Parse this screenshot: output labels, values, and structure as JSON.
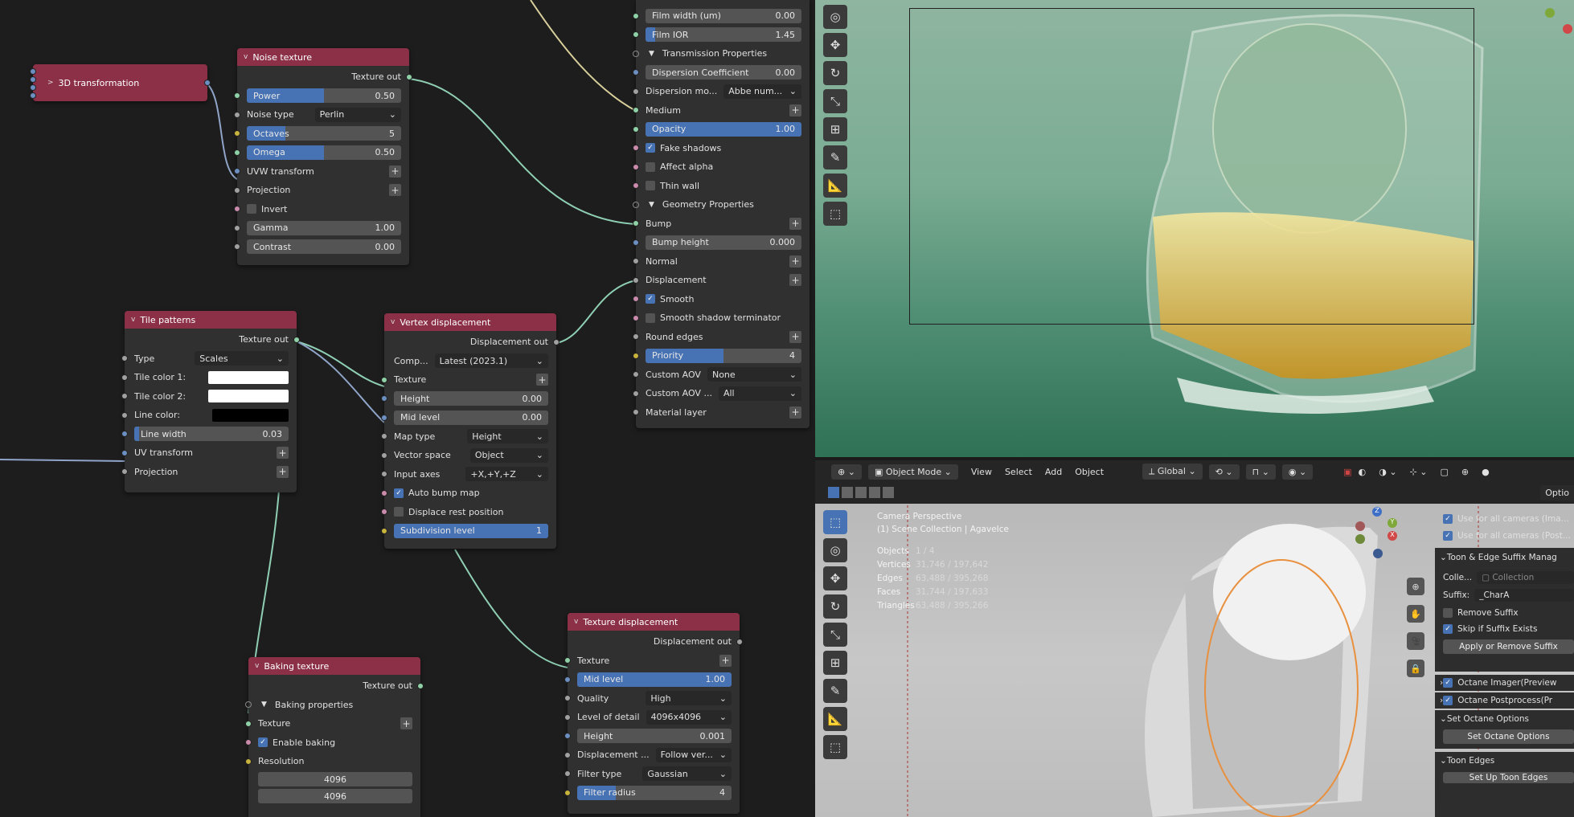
{
  "noise": {
    "title": "Noise texture",
    "out": "Texture out",
    "power": {
      "label": "Power",
      "value": "0.50"
    },
    "noise_type": {
      "label": "Noise type",
      "value": "Perlin"
    },
    "octaves": {
      "label": "Octaves",
      "value": "5"
    },
    "omega": {
      "label": "Omega",
      "value": "0.50"
    },
    "uvw": "UVW transform",
    "projection": "Projection",
    "invert": "Invert",
    "gamma": {
      "label": "Gamma",
      "value": "1.00"
    },
    "contrast": {
      "label": "Contrast",
      "value": "0.00"
    }
  },
  "transform3d": {
    "title": "3D transformation"
  },
  "tile": {
    "title": "Tile patterns",
    "out": "Texture out",
    "type": {
      "label": "Type",
      "value": "Scales"
    },
    "c1": "Tile color 1:",
    "c2": "Tile color 2:",
    "lc": "Line color:",
    "line_width": {
      "label": "Line width",
      "value": "0.03"
    },
    "uv": "UV transform",
    "projection": "Projection"
  },
  "vertex": {
    "title": "Vertex displacement",
    "out": "Displacement out",
    "comp": {
      "label": "Comp...",
      "value": "Latest (2023.1)"
    },
    "texture": "Texture",
    "height": {
      "label": "Height",
      "value": "0.00"
    },
    "mid": {
      "label": "Mid level",
      "value": "0.00"
    },
    "map_type": {
      "label": "Map type",
      "value": "Height"
    },
    "vector_space": {
      "label": "Vector space",
      "value": "Object"
    },
    "input_axes": {
      "label": "Input axes",
      "value": "+X,+Y,+Z"
    },
    "auto_bump": "Auto bump map",
    "displace_rest": "Displace rest position",
    "subdiv": {
      "label": "Subdivision level",
      "value": "1"
    }
  },
  "material": {
    "film_width": {
      "label": "Film width (um)",
      "value": "0.00"
    },
    "film_ior": {
      "label": "Film IOR",
      "value": "1.45"
    },
    "transmission": "Transmission Properties",
    "disp_coef": {
      "label": "Dispersion Coefficient",
      "value": "0.00"
    },
    "disp_mode": {
      "label": "Dispersion mo...",
      "value": "Abbe num..."
    },
    "medium": "Medium",
    "opacity": {
      "label": "Opacity",
      "value": "1.00"
    },
    "fake_shadows": "Fake shadows",
    "affect_alpha": "Affect alpha",
    "thin_wall": "Thin wall",
    "geometry": "Geometry Properties",
    "bump": "Bump",
    "bump_height": {
      "label": "Bump height",
      "value": "0.000"
    },
    "normal": "Normal",
    "displacement": "Displacement",
    "smooth": "Smooth",
    "smooth_shadow": "Smooth shadow terminator",
    "round_edges": "Round edges",
    "priority": {
      "label": "Priority",
      "value": "4"
    },
    "aov1": {
      "label": "Custom AOV",
      "value": "None"
    },
    "aov2": {
      "label": "Custom AOV ...",
      "value": "All"
    },
    "material_layer": "Material layer"
  },
  "texdisp": {
    "title": "Texture displacement",
    "out": "Displacement out",
    "texture": "Texture",
    "mid": {
      "label": "Mid level",
      "value": "1.00"
    },
    "quality": {
      "label": "Quality",
      "value": "High"
    },
    "lod": {
      "label": "Level of detail",
      "value": "4096x4096"
    },
    "height": {
      "label": "Height",
      "value": "0.001"
    },
    "displacement": {
      "label": "Displacement ...",
      "value": "Follow ver..."
    },
    "filter_type": {
      "label": "Filter type",
      "value": "Gaussian"
    },
    "filter_radius": {
      "label": "Filter radius",
      "value": "4"
    }
  },
  "baking": {
    "title": "Baking texture",
    "out": "Texture out",
    "props": "Baking properties",
    "texture": "Texture",
    "enable": "Enable baking",
    "resolution": "Resolution",
    "res_x": "4096",
    "res_y": "4096"
  },
  "viewport_header": {
    "mode": "Object Mode",
    "menu": [
      "View",
      "Select",
      "Add",
      "Object"
    ],
    "orientation": "Global",
    "options": "Optio"
  },
  "stats": {
    "camera": "Camera Perspective",
    "collection": "(1) Scene Collection | AgaveIce",
    "rows": [
      {
        "label": "Objects",
        "value": "1 / 4"
      },
      {
        "label": "Vertices",
        "value": "31,746 / 197,642"
      },
      {
        "label": "Edges",
        "value": "63,488 / 395,268"
      },
      {
        "label": "Faces",
        "value": "31,744 / 197,633"
      },
      {
        "label": "Triangles",
        "value": "63,488 / 395,266"
      }
    ]
  },
  "npanel": {
    "cam1": "Use for all cameras (Ima...",
    "cam2": "Use for all cameras (Post...",
    "suffix_manager": "Toon & Edge Suffix Manag",
    "colle_label": "Colle...",
    "colle_value": "Collection",
    "suffix_label": "Suffix:",
    "suffix_value": "_CharA",
    "remove_suffix": "Remove Suffix",
    "skip_suffix": "Skip if Suffix Exists",
    "apply_btn": "Apply or Remove Suffix",
    "imager": "Octane Imager(Preview",
    "postprocess": "Octane Postprocess(Pr",
    "set_opts_header": "Set Octane Options",
    "set_opts_btn": "Set Octane Options",
    "toon_edges": "Toon Edges",
    "setup_toon": "Set Up Toon Edges"
  }
}
